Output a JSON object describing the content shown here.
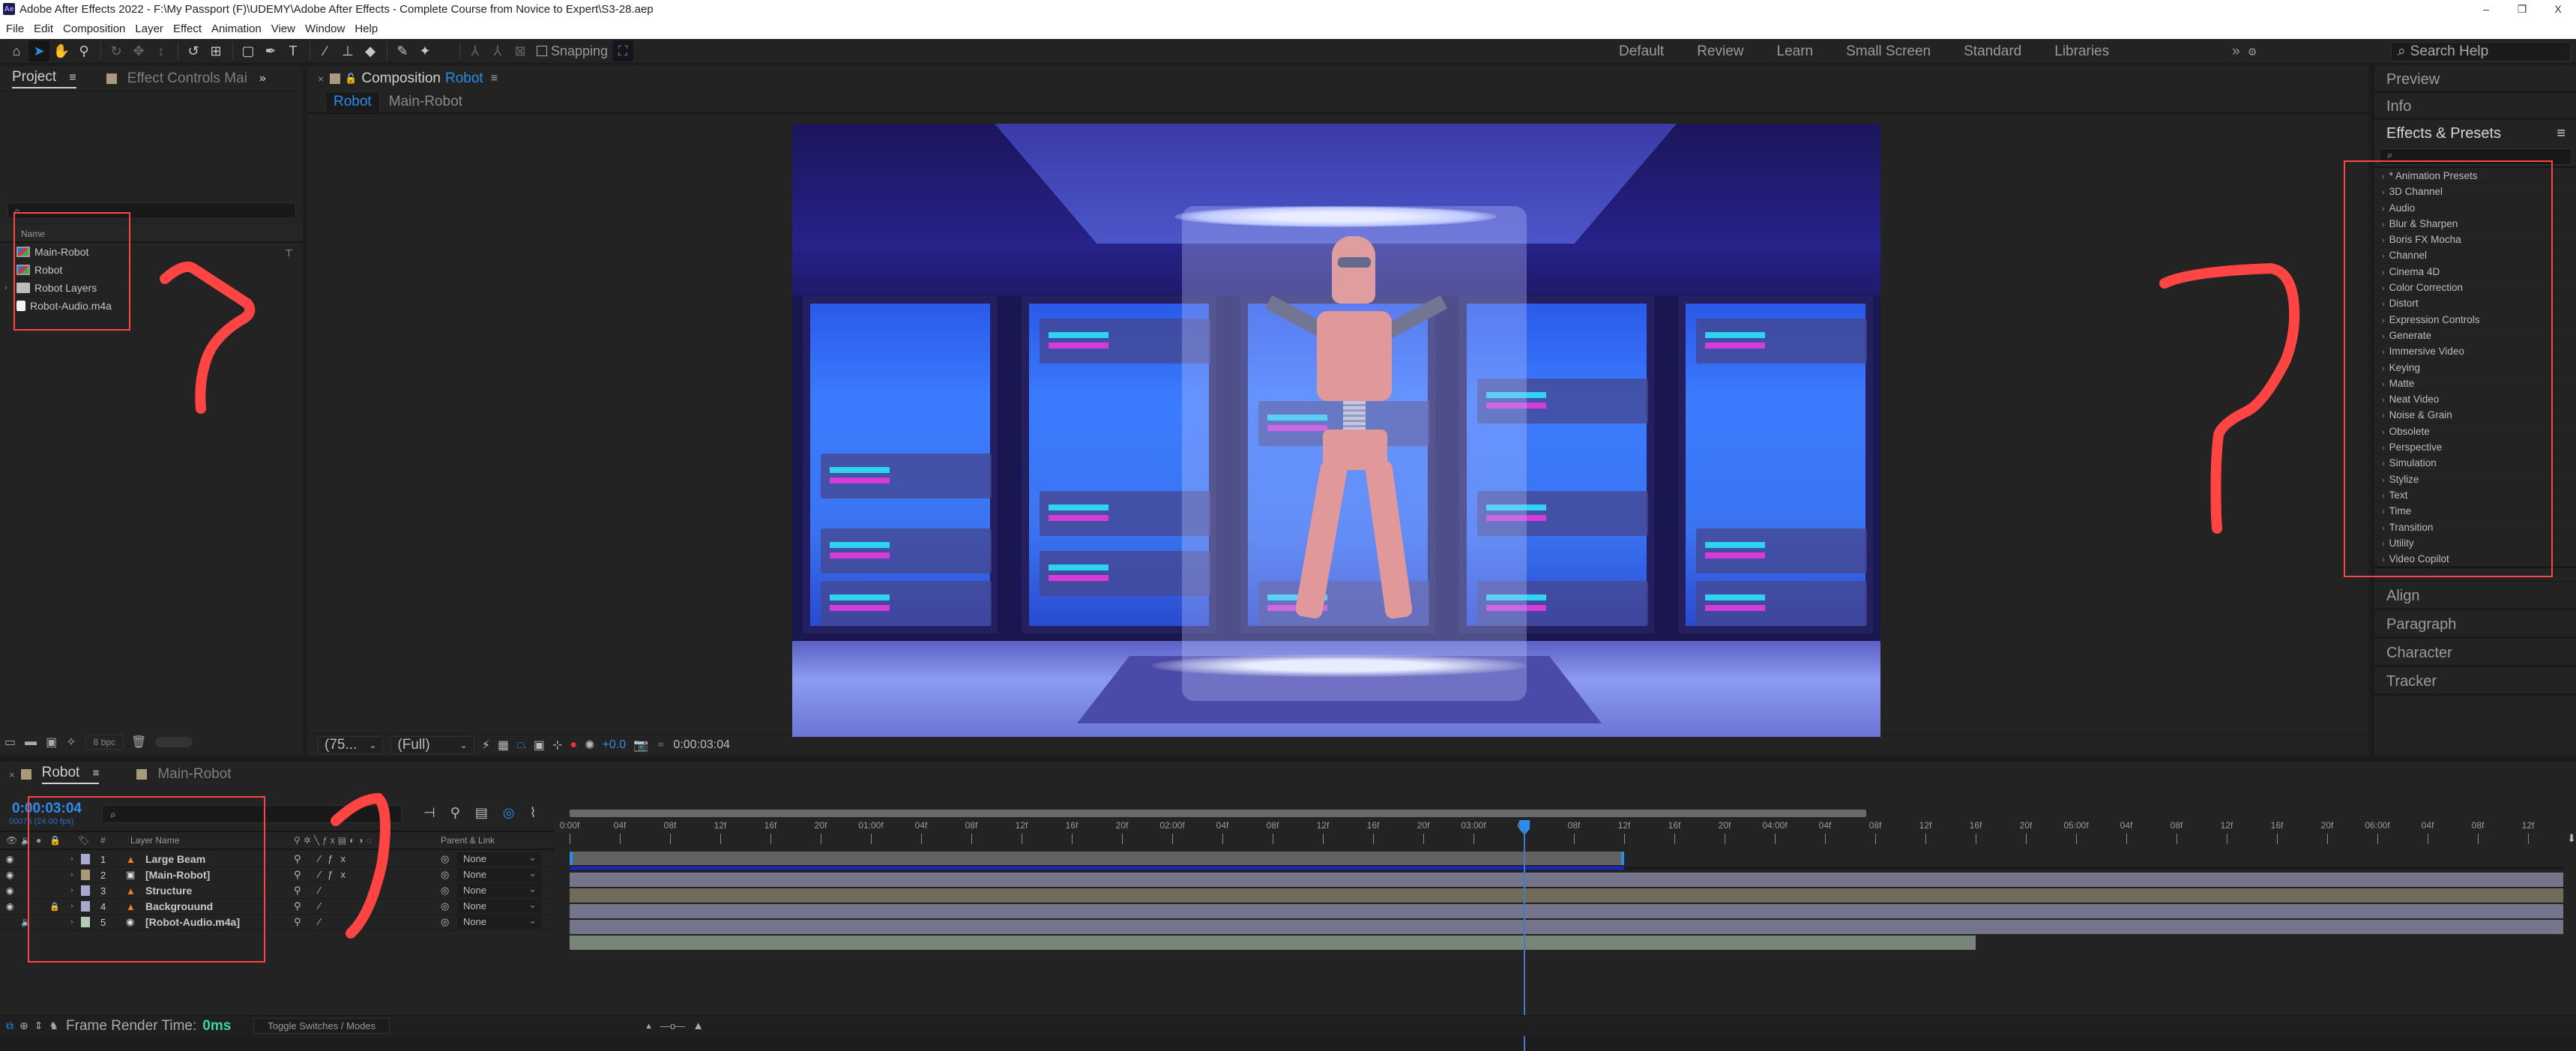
{
  "window": {
    "app_badge": "Ae",
    "title": "Adobe After Effects 2022 - F:\\My Passport (F)\\UDEMY\\Adobe After Effects - Complete Course from Novice to Expert\\S3-28.aep",
    "controls": {
      "minimize": "–",
      "maximize": "❐",
      "close": "X"
    }
  },
  "menu": [
    "File",
    "Edit",
    "Composition",
    "Layer",
    "Effect",
    "Animation",
    "View",
    "Window",
    "Help"
  ],
  "toolbar": {
    "snapping_label": "Snapping",
    "workspaces": [
      "Default",
      "Review",
      "Learn",
      "Small Screen",
      "Standard",
      "Libraries"
    ],
    "overflow": "»",
    "search_help_placeholder": "Search Help"
  },
  "project_panel": {
    "tab_project": "Project",
    "tab_effect_controls": "Effect Controls Mai",
    "overflow": "»",
    "search_placeholder": "⌕",
    "column_name": "Name",
    "items": [
      {
        "name": "Main-Robot",
        "type": "composition"
      },
      {
        "name": "Robot",
        "type": "composition"
      },
      {
        "name": "Robot Layers",
        "type": "folder"
      },
      {
        "name": "Robot-Audio.m4a",
        "type": "audio"
      }
    ],
    "bit_depth": "8 bpc"
  },
  "composition_panel": {
    "tab_prefix": "Composition",
    "tab_comp_name": "Robot",
    "breadcrumbs": [
      "Robot",
      "Main-Robot"
    ],
    "footer": {
      "magnification": "(75...",
      "resolution": "(Full)",
      "exposure": "+0.0",
      "current_time": "0:00:03:04"
    }
  },
  "right_panels": {
    "preview": "Preview",
    "info": "Info",
    "effects_presets": "Effects & Presets",
    "effects_categories": [
      "* Animation Presets",
      "3D Channel",
      "Audio",
      "Blur & Sharpen",
      "Boris FX Mocha",
      "Channel",
      "Cinema 4D",
      "Color Correction",
      "Distort",
      "Expression Controls",
      "Generate",
      "Immersive Video",
      "Keying",
      "Matte",
      "Neat Video",
      "Noise & Grain",
      "Obsolete",
      "Perspective",
      "Simulation",
      "Stylize",
      "Text",
      "Time",
      "Transition",
      "Utility",
      "Video Copilot"
    ],
    "collapsed": [
      "Align",
      "Paragraph",
      "Character",
      "Tracker"
    ]
  },
  "timeline": {
    "tabs": [
      {
        "label": "Robot",
        "active": true
      },
      {
        "label": "Main-Robot",
        "active": false
      }
    ],
    "current_time": "0:00:03:04",
    "current_frame_info": "00076 (24.00 fps)",
    "columns": {
      "number": "#",
      "layer_name": "Layer Name",
      "parent_link": "Parent & Link"
    },
    "layers": [
      {
        "index": "1",
        "name": "Large Beam",
        "type": "shape",
        "label_color": "#a9a9cc",
        "visible": true,
        "audio": false,
        "locked": false,
        "has_fx": true,
        "parent": "None",
        "bar_color": "#74748a"
      },
      {
        "index": "2",
        "name": "[Main-Robot]",
        "type": "composition",
        "label_color": "#a99a7c",
        "visible": true,
        "audio": false,
        "locked": false,
        "has_fx": true,
        "parent": "None",
        "bar_color": "#726a5a"
      },
      {
        "index": "3",
        "name": "Structure",
        "type": "shape",
        "label_color": "#a9a9cc",
        "visible": true,
        "audio": false,
        "locked": false,
        "has_fx": false,
        "parent": "None",
        "bar_color": "#74748a"
      },
      {
        "index": "4",
        "name": "Backgrouund",
        "type": "shape",
        "label_color": "#a9a9cc",
        "visible": true,
        "audio": false,
        "locked": true,
        "has_fx": false,
        "parent": "None",
        "bar_color": "#74748a"
      },
      {
        "index": "5",
        "name": "[Robot-Audio.m4a]",
        "type": "audio",
        "label_color": "#b5cbb3",
        "visible": false,
        "audio": true,
        "locked": false,
        "has_fx": false,
        "parent": "None",
        "bar_color": "#798579"
      }
    ],
    "ruler_labels": [
      "0:00f",
      "04f",
      "08f",
      "12f",
      "16f",
      "20f",
      "01:00f",
      "04f",
      "08f",
      "12f",
      "16f",
      "20f",
      "02:00f",
      "04f",
      "08f",
      "12f",
      "16f",
      "20f",
      "03:00f",
      "04f",
      "08f",
      "12f",
      "16f",
      "20f",
      "04:00f",
      "04f",
      "08f",
      "12f",
      "16f",
      "20f",
      "05:00f",
      "04f",
      "08f",
      "12f",
      "16f",
      "20f",
      "06:00f",
      "04f",
      "08f",
      "12f"
    ],
    "playhead_frame": 76,
    "work_area_end_frame": 84,
    "audio_end_frame": 112,
    "status": {
      "frame_render_label": "Frame Render Time:",
      "frame_render_value": "0ms",
      "toggle_label": "Toggle Switches / Modes"
    }
  },
  "colors": {
    "accent_blue": "#2d8ceb",
    "annotation_red": "#ff4444",
    "render_time_green": "#3fd3a8"
  }
}
